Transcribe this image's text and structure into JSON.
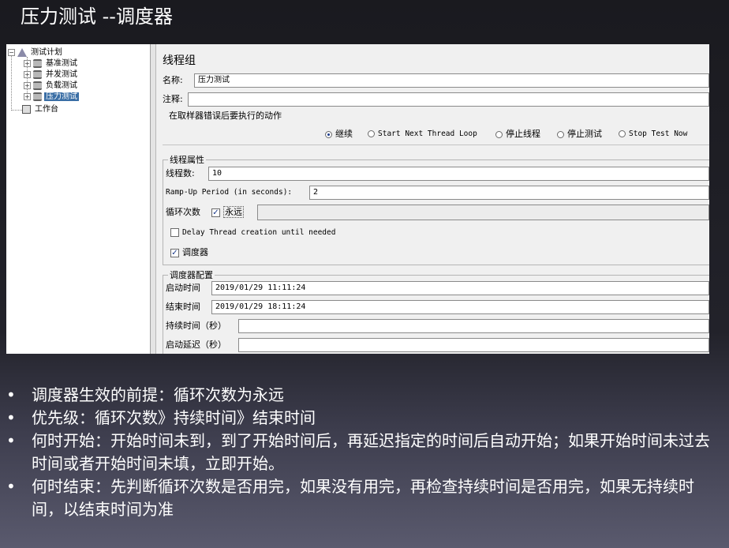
{
  "slide": {
    "title": "压力测试 --调度器",
    "bullets": [
      "调度器生效的前提：循环次数为永远",
      "优先级：循环次数》持续时间》结束时间",
      "何时开始：开始时间未到，到了开始时间后，再延迟指定的时间后自动开始；如果开始时间未过去时间或者开始时间未填，立即开始。",
      "何时结束：先判断循环次数是否用完，如果没有用完，再检查持续时间是否用完，如果无持续时间，以结束时间为准"
    ],
    "bullet_glyph": "•"
  },
  "tree": {
    "root_label": "测试计划",
    "items": [
      {
        "label": "基准测试",
        "icon": "spool-icon",
        "selected": false
      },
      {
        "label": "并发测试",
        "icon": "spool-icon",
        "selected": false
      },
      {
        "label": "负载测试",
        "icon": "spool-icon",
        "selected": false
      },
      {
        "label": "压力测试",
        "icon": "spool-icon",
        "selected": true
      }
    ],
    "workbench_label": "工作台",
    "expand_glyph": "+",
    "collapse_glyph": "−"
  },
  "panel": {
    "title": "线程组",
    "name_label": "名称:",
    "name_value": "压力测试",
    "comment_label": "注释:",
    "comment_value": "",
    "on_error": {
      "title": "在取样器错误后要执行的动作",
      "options": [
        "继续",
        "Start Next Thread Loop",
        "停止线程",
        "停止测试",
        "Stop Test Now"
      ],
      "selected": "继续"
    },
    "thread_props": {
      "title": "线程属性",
      "threads_label": "线程数:",
      "threads_value": "10",
      "rampup_label": "Ramp-Up Period (in seconds):",
      "rampup_value": "2",
      "loop_label": "循环次数",
      "forever_label": "永远",
      "forever_checked": true,
      "delay_label": "Delay Thread creation until needed",
      "delay_checked": false,
      "scheduler_label": "调度器",
      "scheduler_checked": true
    },
    "scheduler": {
      "title": "调度器配置",
      "start_label": "启动时间",
      "start_value": "2019/01/29 11:11:24",
      "end_label": "结束时间",
      "end_value": "2019/01/29 18:11:24",
      "duration_label": "持续时间（秒）",
      "duration_value": "",
      "delay_label": "启动延迟（秒）",
      "delay_value": ""
    },
    "check_glyph": "✓"
  },
  "colors": {
    "selection": "#3a6ea5",
    "slide_background": "#1a1a1f",
    "text_white": "#ffffff"
  }
}
